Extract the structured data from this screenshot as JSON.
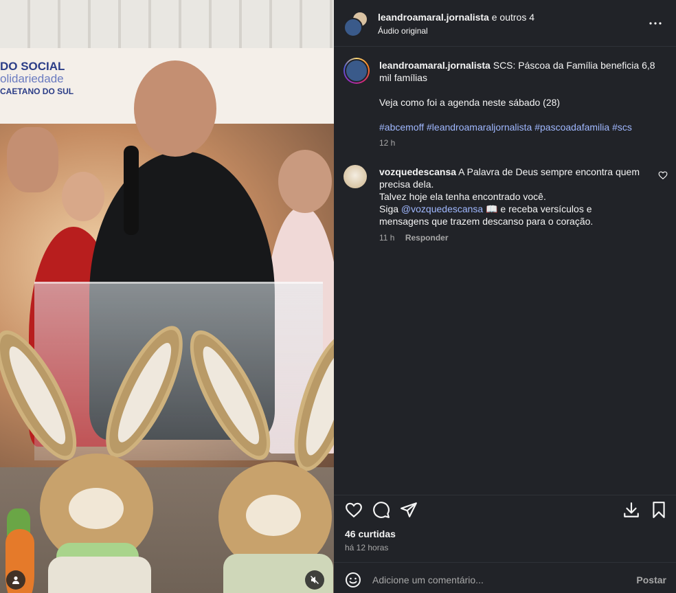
{
  "header": {
    "username": "leandroamaral.jornalista",
    "others": " e outros 4",
    "audio": "Áudio original"
  },
  "media": {
    "banner_line1": "DO SOCIAL",
    "banner_line2": "olidariedade",
    "banner_line3": "CAETANO DO SUL"
  },
  "caption": {
    "username": "leandroamaral.jornalista",
    "text": " SCS: Páscoa da Família beneficia 6,8 mil famílias",
    "line2": "Veja como foi a agenda neste sábado (28)",
    "hashtags": [
      "#abcemoff",
      "#leandroamaraljornalista",
      "#pascoadafamilia",
      "#scs"
    ],
    "time": "12 h"
  },
  "comment": {
    "username": "vozquedescansa",
    "text1": " A Palavra de Deus sempre encontra quem precisa dela.",
    "text2": "Talvez hoje ela tenha encontrado você.",
    "text3a": "Siga ",
    "mention": "@vozquedescansa",
    "text3b": " 📖 e receba versículos e mensagens que trazem descanso para o coração.",
    "time": "11 h",
    "reply": "Responder"
  },
  "stats": {
    "likes": "46 curtidas",
    "ago": "há 12 horas"
  },
  "comment_bar": {
    "placeholder": "Adicione um comentário...",
    "post": "Postar"
  },
  "icons": {
    "like": "heart-icon",
    "comment": "comment-icon",
    "share": "share-icon",
    "save": "bookmark-icon",
    "download": "download-icon",
    "emoji": "emoji-icon",
    "more": "more-icon",
    "mute": "mute-icon",
    "user_tag": "user-tag-icon"
  },
  "colors": {
    "panel_bg": "#212328",
    "link": "#a0b8ff",
    "muted": "#a8a8a8"
  }
}
